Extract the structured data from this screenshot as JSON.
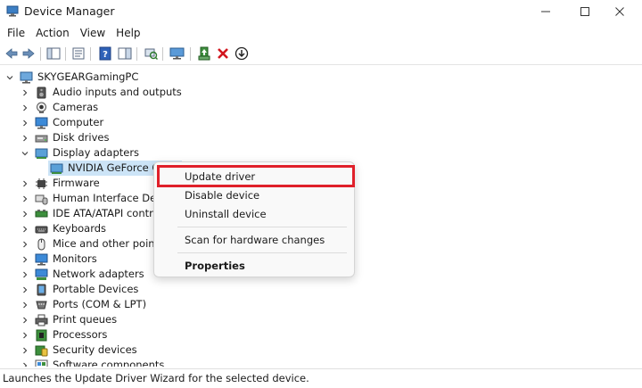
{
  "window": {
    "title": "Device Manager"
  },
  "menu": {
    "file": "File",
    "action": "Action",
    "view": "View",
    "help": "Help"
  },
  "tree": {
    "root": "SKYGEARGamingPC",
    "categories": [
      {
        "label": "Audio inputs and outputs",
        "icon": "speaker-icon"
      },
      {
        "label": "Cameras",
        "icon": "camera-icon"
      },
      {
        "label": "Computer",
        "icon": "computer-icon"
      },
      {
        "label": "Disk drives",
        "icon": "disk-drive-icon"
      },
      {
        "label": "Display adapters",
        "icon": "display-adapter-icon",
        "expanded": true
      },
      {
        "label": "Firmware",
        "icon": "firmware-icon"
      },
      {
        "label": "Human Interface Devic",
        "icon": "hid-icon"
      },
      {
        "label": "IDE ATA/ATAPI controll",
        "icon": "ide-controller-icon"
      },
      {
        "label": "Keyboards",
        "icon": "keyboard-icon"
      },
      {
        "label": "Mice and other pointin",
        "icon": "mouse-icon"
      },
      {
        "label": "Monitors",
        "icon": "monitor-icon"
      },
      {
        "label": "Network adapters",
        "icon": "network-adapter-icon"
      },
      {
        "label": "Portable Devices",
        "icon": "portable-device-icon"
      },
      {
        "label": "Ports (COM & LPT)",
        "icon": "port-icon"
      },
      {
        "label": "Print queues",
        "icon": "printer-icon"
      },
      {
        "label": "Processors",
        "icon": "processor-icon"
      },
      {
        "label": "Security devices",
        "icon": "security-device-icon"
      },
      {
        "label": "Software components",
        "icon": "software-component-icon"
      }
    ],
    "display_child": "NVIDIA GeForce GT"
  },
  "context_menu": {
    "update_driver": "Update driver",
    "disable_device": "Disable device",
    "uninstall_device": "Uninstall device",
    "scan_hardware": "Scan for hardware changes",
    "properties": "Properties"
  },
  "status": {
    "text": "Launches the Update Driver Wizard for the selected device."
  },
  "colors": {
    "highlight": "#e0202a",
    "selection": "#cce4f7",
    "accent": "#2a6fc4"
  }
}
